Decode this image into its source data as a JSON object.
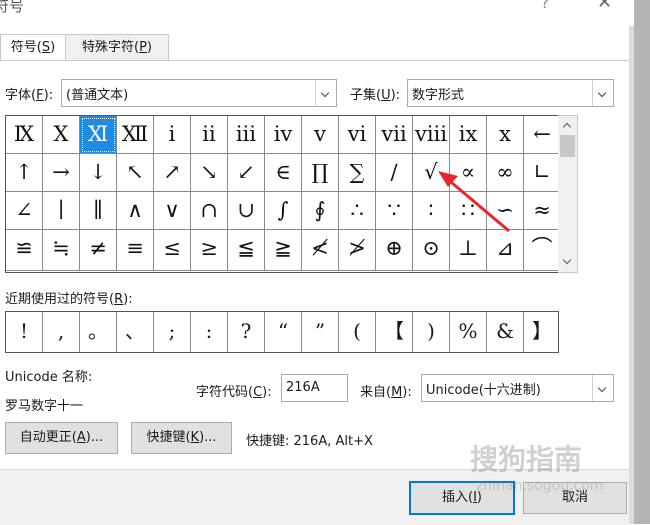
{
  "window": {
    "title": "符号",
    "help": "?",
    "close": "✕"
  },
  "tabs": [
    {
      "label": "符号(S)",
      "text": "符号(",
      "key": "S",
      "tail": ")"
    },
    {
      "label": "特殊字符(P)",
      "text": "特殊字符(",
      "key": "P",
      "tail": ")"
    }
  ],
  "font": {
    "label_text": "字体(",
    "label_key": "F",
    "label_tail": "):",
    "value": "(普通文本)"
  },
  "subset": {
    "label_text": "子集(",
    "label_key": "U",
    "label_tail": "):",
    "value": "数字形式"
  },
  "symbol_grid": {
    "rows": [
      [
        "Ⅸ",
        "Ⅹ",
        "Ⅺ",
        "Ⅻ",
        "ⅰ",
        "ⅱ",
        "ⅲ",
        "ⅳ",
        "ⅴ",
        "ⅵ",
        "ⅶ",
        "ⅷ",
        "ⅸ",
        "ⅹ",
        "←"
      ],
      [
        "↑",
        "→",
        "↓",
        "↖",
        "↗",
        "↘",
        "↙",
        "∈",
        "∏",
        "∑",
        "∕",
        "√",
        "∝",
        "∞",
        "∟"
      ],
      [
        "∠",
        "∣",
        "∥",
        "∧",
        "∨",
        "∩",
        "∪",
        "∫",
        "∮",
        "∴",
        "∵",
        "∶",
        "∷",
        "∽",
        "≈"
      ],
      [
        "≌",
        "≒",
        "≠",
        "≡",
        "≤",
        "≥",
        "≦",
        "≧",
        "≮",
        "≯",
        "⊕",
        "⊙",
        "⊥",
        "⊿",
        "⌒"
      ]
    ],
    "selected": "Ⅺ"
  },
  "recent": {
    "label_text": "近期使用过的符号(",
    "label_key": "R",
    "label_tail": "):",
    "symbols": [
      "!",
      ",",
      "。",
      "、",
      ";",
      ":",
      "?",
      "“",
      "”",
      "(",
      "【",
      ")",
      "%",
      "&",
      "】"
    ]
  },
  "unicode_name": {
    "label": "Unicode 名称:",
    "value": "罗马数字十一"
  },
  "char_code": {
    "label_text": "字符代码(",
    "label_key": "C",
    "label_tail": "):",
    "value": "216A"
  },
  "from": {
    "label_text": "来自(",
    "label_key": "M",
    "label_tail": "):",
    "value": "Unicode(十六进制)"
  },
  "buttons": {
    "autocorrect": {
      "text": "自动更正(",
      "key": "A",
      "tail": ")..."
    },
    "shortcut": {
      "text": "快捷键(",
      "key": "K",
      "tail": ")..."
    },
    "insert": {
      "text": "插入(",
      "key": "I",
      "tail": ")"
    },
    "cancel": "取消"
  },
  "shortcut_info": "快捷键: 216A, Alt+X",
  "watermark": {
    "brand": "搜狗指南",
    "url": "zhinan.sogou.com"
  },
  "colors": {
    "selection": "#1e8ce6",
    "annotation_arrow": "#e8262c",
    "primary_border": "#0078d7"
  }
}
